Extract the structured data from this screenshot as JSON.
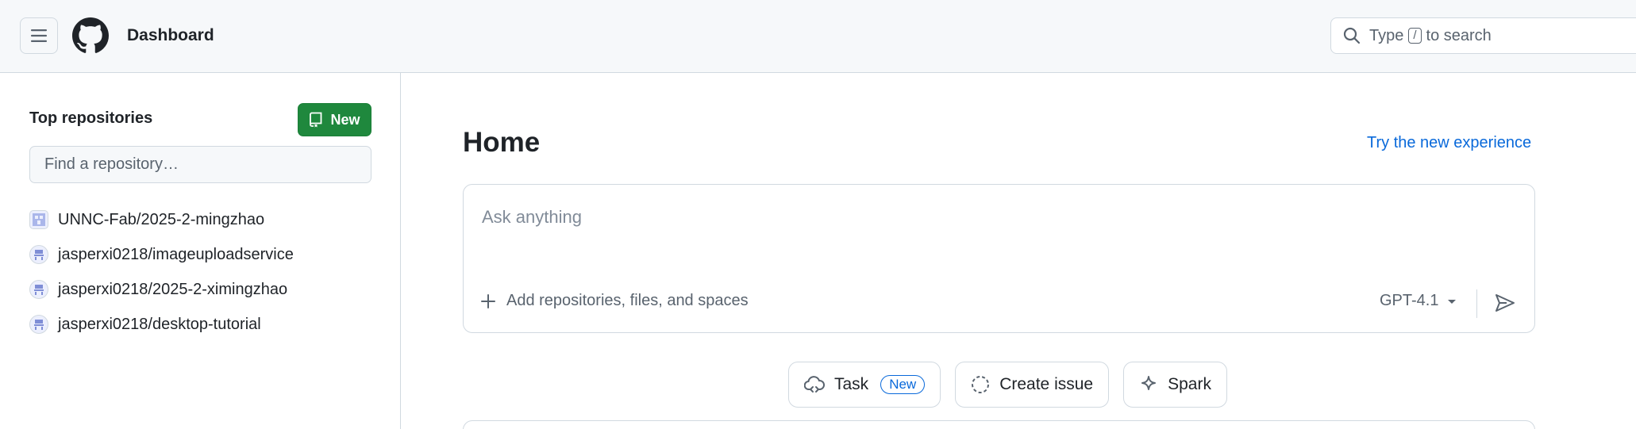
{
  "header": {
    "title": "Dashboard",
    "search": {
      "prefix": "Type",
      "key": "/",
      "suffix": "to search"
    }
  },
  "sidebar": {
    "title": "Top repositories",
    "new_button": "New",
    "find_placeholder": "Find a repository…",
    "repos": [
      {
        "name": "UNNC-Fab/2025-2-mingzhao",
        "avatar": "org-avatar"
      },
      {
        "name": "jasperxi0218/imageuploadservice",
        "avatar": "user-avatar"
      },
      {
        "name": "jasperxi0218/2025-2-ximingzhao",
        "avatar": "user-avatar"
      },
      {
        "name": "jasperxi0218/desktop-tutorial",
        "avatar": "user-avatar"
      }
    ]
  },
  "main": {
    "title": "Home",
    "try_link": "Try the new experience",
    "ask": {
      "placeholder": "Ask anything",
      "add_label": "Add repositories, files, and spaces",
      "model": "GPT-4.1"
    },
    "actions": {
      "task": "Task",
      "task_badge": "New",
      "create_issue": "Create issue",
      "spark": "Spark"
    }
  },
  "colors": {
    "new_button": "#1f883d",
    "link": "#0969da",
    "border": "#d1d9e0",
    "header_bg": "#f6f8fa"
  }
}
